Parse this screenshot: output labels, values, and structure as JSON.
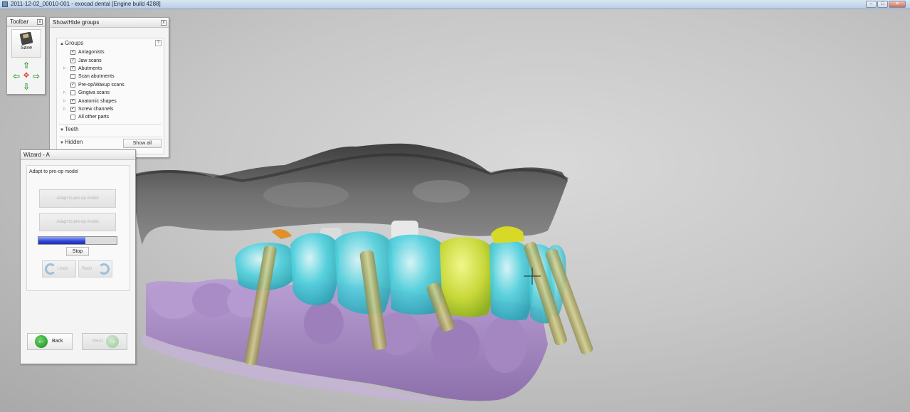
{
  "window": {
    "title": "2011-12-02_00010-001 - exocad dental [Engine build 4288]",
    "minimize": "–",
    "maximize": "□",
    "close": "✕"
  },
  "toolbar": {
    "title": "Toolbar",
    "pin": "x",
    "save_label": "Save",
    "arrows": {
      "up": "⇧",
      "down": "⇩",
      "left": "⇦",
      "right": "⇨",
      "center": "✥"
    }
  },
  "show_hide": {
    "title": "Show/Hide groups",
    "pin": "x",
    "groups_label": "Groups",
    "help": "?",
    "groups": [
      {
        "label": "Antagonists",
        "checked": true,
        "expandable": false
      },
      {
        "label": "Jaw scans",
        "checked": true,
        "expandable": false
      },
      {
        "label": "Abutments",
        "checked": true,
        "expandable": true
      },
      {
        "label": "Scan abutments",
        "checked": false,
        "expandable": false
      },
      {
        "label": "Pre-op/Waxup scans",
        "checked": true,
        "expandable": false
      },
      {
        "label": "Gingiva scans",
        "checked": false,
        "expandable": true
      },
      {
        "label": "Anatomic shapes",
        "checked": true,
        "expandable": true
      },
      {
        "label": "Screw channels",
        "checked": true,
        "expandable": true
      },
      {
        "label": "All other parts",
        "checked": false,
        "expandable": false
      }
    ],
    "teeth_label": "Teeth",
    "hidden_label": "Hidden",
    "show_all_label": "Show all"
  },
  "wizard": {
    "title": "Wizard - A",
    "step_title": "Adapt to pre-op model",
    "button1": "Adapt to pre-op model",
    "button2": "Adapt to pre-op model",
    "progress": 0.6,
    "stop_label": "Stop",
    "undo_label": "Undo",
    "redo_label": "Redo",
    "back_label": "Back",
    "next_label": "Next"
  },
  "colors": {
    "upper_jaw": "#5f5f5f",
    "lower_jaw": "#a98bc6",
    "crowns": "#47d6e3",
    "highlight_crown": "#c9de3a",
    "implants": "#b7b26e"
  }
}
